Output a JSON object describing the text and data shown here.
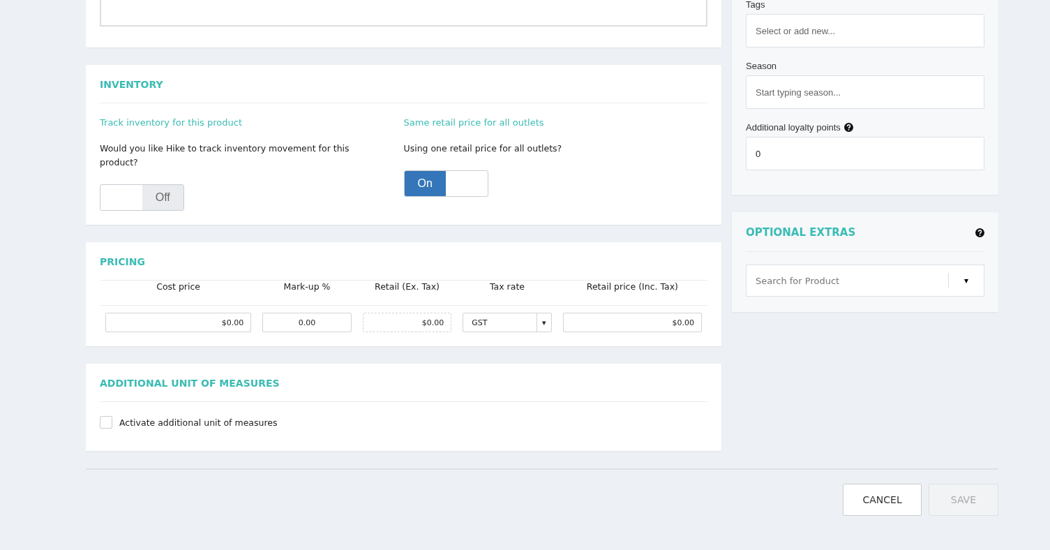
{
  "inventory": {
    "title": "INVENTORY",
    "options": [
      {
        "heading": "Track inventory for this product",
        "question": "Would you like Hike to track inventory movement for this product?",
        "toggle": {
          "on": false,
          "label": "Off"
        }
      },
      {
        "heading": "Same retail price for all outlets",
        "question": "Using one retail price for all outlets?",
        "toggle": {
          "on": true,
          "label": "On"
        }
      }
    ]
  },
  "pricing": {
    "title": "PRICING",
    "columns": [
      {
        "heading": "Cost price",
        "kind": "input",
        "value": "$0.00"
      },
      {
        "heading": "Mark-up %",
        "kind": "input-center",
        "value": "0.00"
      },
      {
        "heading": "Retail (Ex. Tax)",
        "kind": "readonly",
        "value": "$0.00"
      },
      {
        "heading": "Tax rate",
        "kind": "select",
        "value": "GST",
        "caret": "▾"
      },
      {
        "heading": "Retail price (Inc. Tax)",
        "kind": "input",
        "value": "$0.00"
      }
    ]
  },
  "unit_of_measures": {
    "title": "ADDITIONAL UNIT OF MEASURES",
    "checkbox": {
      "label": "Activate additional unit of measures",
      "checked": false
    }
  },
  "details": {
    "fields": [
      {
        "label": "Tags",
        "placeholder": "Select or add new...",
        "help": false
      },
      {
        "label": "Season",
        "placeholder": "Start typing season...",
        "help": false
      },
      {
        "label": "Additional loyalty points",
        "value": "0",
        "help": true
      }
    ]
  },
  "optional_extras": {
    "title": "OPTIONAL EXTRAS",
    "search": {
      "placeholder": "Search for Product",
      "caret": "▾"
    }
  },
  "buttons": [
    {
      "label": "CANCEL",
      "disabled": false
    },
    {
      "label": "SAVE",
      "disabled": true
    }
  ]
}
